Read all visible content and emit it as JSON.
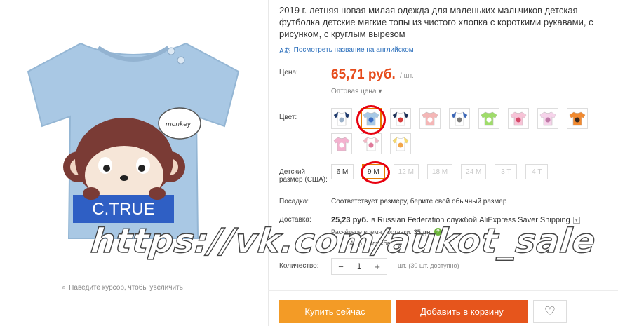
{
  "gallery": {
    "shirt_text": "C.TRUE",
    "bubble_text": "monkey",
    "zoom_hint": "Наведите курсор, чтобы увеличить"
  },
  "product": {
    "title": "2019 г. летняя новая милая одежда для маленьких мальчиков детская футболка детские мягкие топы из чистого хлопка с короткими рукавами, с рисунком, с круглым вырезом",
    "translate_link": "Посмотреть название на английском"
  },
  "price": {
    "label": "Цена:",
    "value": "65,71 руб.",
    "unit": "/ шт.",
    "wholesale": "Оптовая цена"
  },
  "color": {
    "label": "Цвет:",
    "selected_index": 1,
    "swatches": [
      {
        "name": "white-navy-swatch",
        "body": "#ffffff",
        "sleeve": "#1f3b6e",
        "print": "#9ab0c8"
      },
      {
        "name": "light-blue-monkey-swatch",
        "body": "#a8c9e6",
        "sleeve": "#a8c9e6",
        "print": "#3b6cc4"
      },
      {
        "name": "navy-raglan-swatch",
        "body": "#ffffff",
        "sleeve": "#1a2d55",
        "print": "#d63a3a"
      },
      {
        "name": "pink-swatch",
        "body": "#f4b6b6",
        "sleeve": "#f4b6b6",
        "print": "#ffffff"
      },
      {
        "name": "blue-raglan-swatch",
        "body": "#ffffff",
        "sleeve": "#3a66b8",
        "print": "#7a7a7a"
      },
      {
        "name": "green-swatch",
        "body": "#9fdc6a",
        "sleeve": "#9fdc6a",
        "print": "#ffffff"
      },
      {
        "name": "pink-car-swatch",
        "body": "#f7c3d7",
        "sleeve": "#f7c3d7",
        "print": "#d64a6a"
      },
      {
        "name": "light-pink-swatch",
        "body": "#f6d3ea",
        "sleeve": "#f6d3ea",
        "print": "#c07aa8"
      },
      {
        "name": "orange-swatch",
        "body": "#f28a30",
        "sleeve": "#f28a30",
        "print": "#3b2a1f"
      },
      {
        "name": "pink-print-swatch",
        "body": "#f4b2cf",
        "sleeve": "#f4b2cf",
        "print": "#ffffff"
      },
      {
        "name": "white-pink-swatch",
        "body": "#ffffff",
        "sleeve": "#f2b8c6",
        "print": "#e07a9a"
      },
      {
        "name": "yellow-swatch",
        "body": "#ffffff",
        "sleeve": "#f6d96a",
        "print": "#f2a64a"
      }
    ]
  },
  "size": {
    "label": "Детский размер (США):",
    "selected_index": 1,
    "options": [
      {
        "label": "6 M",
        "disabled": false
      },
      {
        "label": "9 M",
        "disabled": false
      },
      {
        "label": "12 M",
        "disabled": true
      },
      {
        "label": "18 M",
        "disabled": true
      },
      {
        "label": "24 M",
        "disabled": true
      },
      {
        "label": "3 T",
        "disabled": true
      },
      {
        "label": "4 T",
        "disabled": true
      }
    ]
  },
  "fit": {
    "label": "Посадка:",
    "text": "Соответствует размеру, берите свой обычный размер"
  },
  "shipping": {
    "label": "Доставка:",
    "price": "25,23 руб.",
    "service_text": "в Russian Federation службой AliExpress Saver Shipping",
    "eta_label": "Расчётное время доставки:",
    "eta_value": "35 дн.",
    "more": "Е... (8,48 р... службами)"
  },
  "quantity": {
    "label": "Количество:",
    "value": "1",
    "available": "шт. (30 шт. доступно)"
  },
  "actions": {
    "buy_now": "Купить сейчас",
    "add_to_cart": "Добавить в корзину"
  },
  "watermark": "https://vk.com/aukot_sale"
}
